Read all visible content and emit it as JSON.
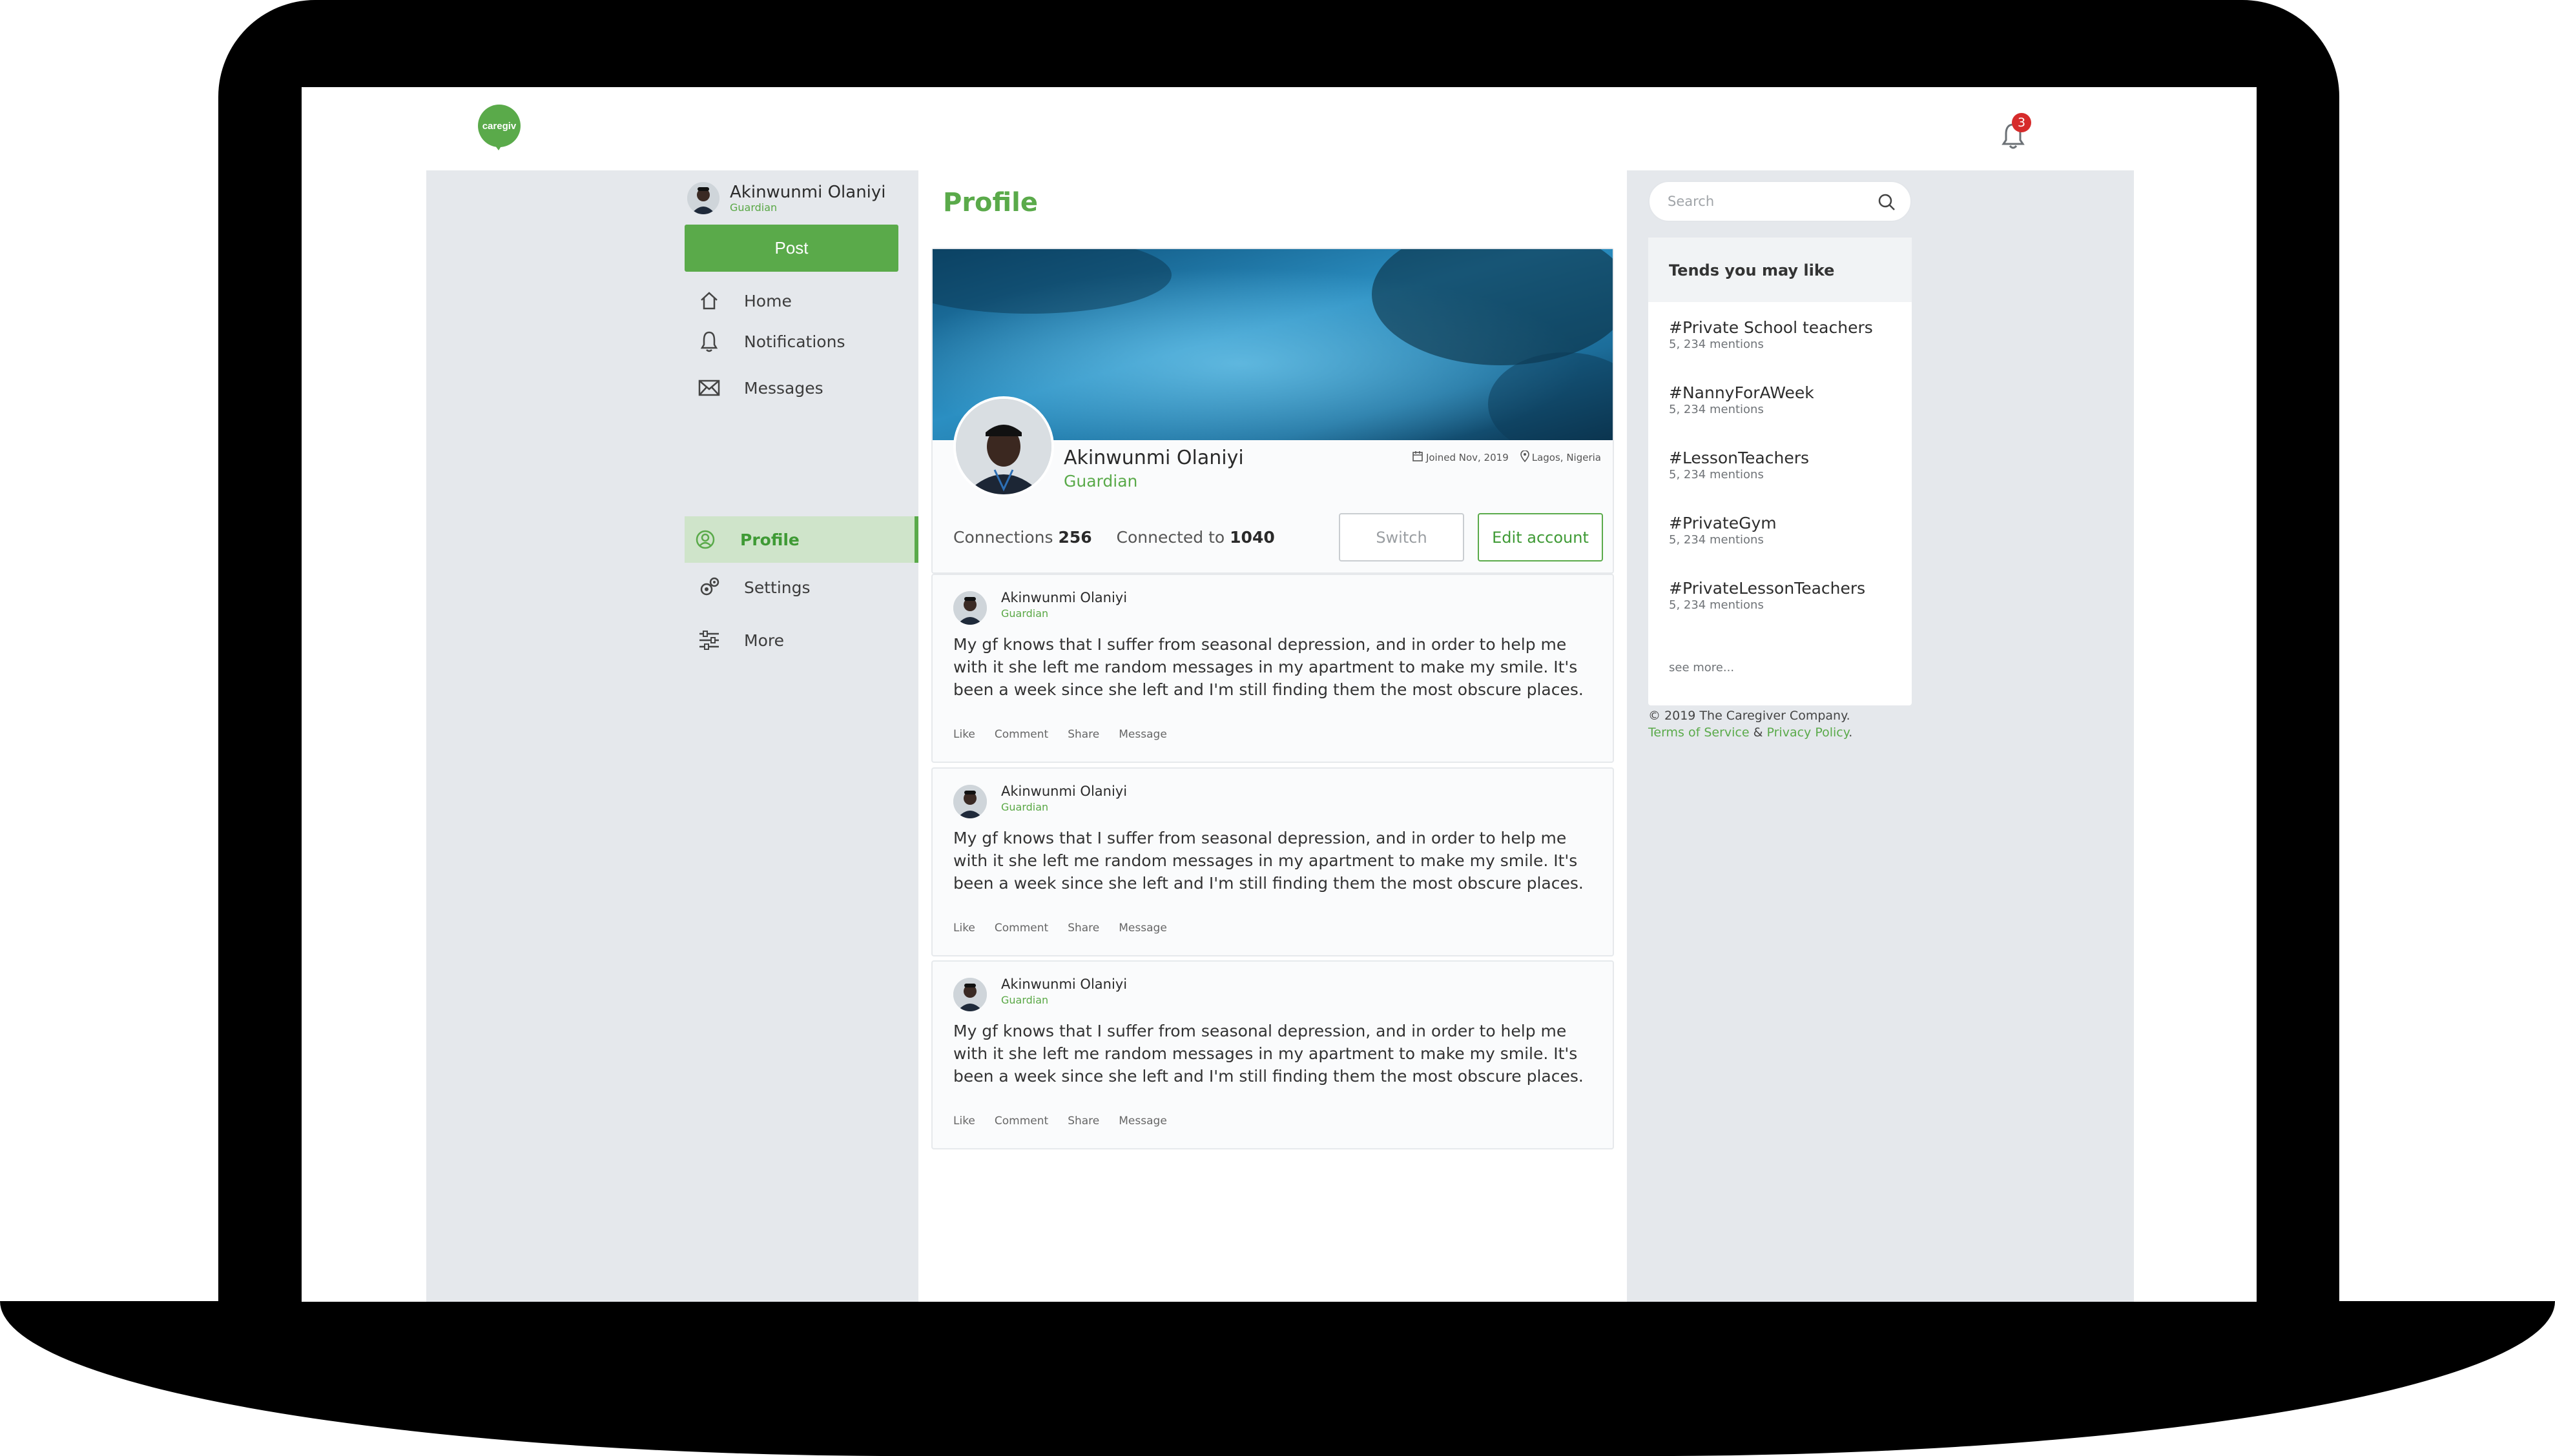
{
  "app": {
    "logo_text": "caregiv",
    "notification_count": "3",
    "brand_color": "#5aaa4a"
  },
  "sidebar": {
    "user": {
      "name": "Akinwunmi Olaniyi",
      "role": "Guardian"
    },
    "post_label": "Post",
    "items": [
      {
        "label": "Home",
        "icon": "home-icon"
      },
      {
        "label": "Notifications",
        "icon": "bell-icon"
      },
      {
        "label": "Messages",
        "icon": "envelope-icon"
      },
      {
        "label": "Profile",
        "icon": "profile-icon",
        "active": true
      },
      {
        "label": "Settings",
        "icon": "gear-icon"
      },
      {
        "label": "More",
        "icon": "sliders-icon"
      }
    ]
  },
  "main": {
    "title": "Profile",
    "profile": {
      "name": "Akinwunmi Olaniyi",
      "role": "Guardian",
      "joined": "Joined Nov, 2019",
      "location": "Lagos, Nigeria",
      "connections_label": "Connections",
      "connections_value": "256",
      "connected_label": "Connected to",
      "connected_value": "1040",
      "switch_label": "Switch",
      "edit_label": "Edit account"
    },
    "posts": [
      {
        "author": "Akinwunmi Olaniyi",
        "role": "Guardian",
        "text": "My gf knows that I suffer from seasonal depression, and in order to help me with it she left me random messages in my apartment to make my smile. It's been a week since she left and I'm still finding them the most obscure places.",
        "actions": [
          "Like",
          "Comment",
          "Share",
          "Message"
        ]
      },
      {
        "author": "Akinwunmi Olaniyi",
        "role": "Guardian",
        "text": "My gf knows that I suffer from seasonal depression, and in order to help me with it she left me random messages in my apartment to make my smile. It's been a week since she left and I'm still finding them the most obscure places.",
        "actions": [
          "Like",
          "Comment",
          "Share",
          "Message"
        ]
      },
      {
        "author": "Akinwunmi Olaniyi",
        "role": "Guardian",
        "text": "My gf knows that I suffer from seasonal depression, and in order to help me with it she left me random messages in my apartment to make my smile. It's been a week since she left and I'm still finding them the most obscure places.",
        "actions": [
          "Like",
          "Comment",
          "Share",
          "Message"
        ]
      }
    ]
  },
  "right": {
    "search_placeholder": "Search",
    "trends_title": "Tends you may like",
    "trends": [
      {
        "tag": "#Private School teachers",
        "mentions": "5, 234 mentions"
      },
      {
        "tag": "#NannyForAWeek",
        "mentions": "5, 234 mentions"
      },
      {
        "tag": "#LessonTeachers",
        "mentions": "5, 234 mentions"
      },
      {
        "tag": "#PrivateGym",
        "mentions": "5, 234 mentions"
      },
      {
        "tag": "#PrivateLessonTeachers",
        "mentions": "5, 234 mentions"
      }
    ],
    "see_more": "see more...",
    "footer": {
      "copyright": "© 2019 The Caregiver Company.",
      "terms": "Terms of Service",
      "amp": "&",
      "privacy": "Privacy Policy",
      "period": "."
    }
  }
}
